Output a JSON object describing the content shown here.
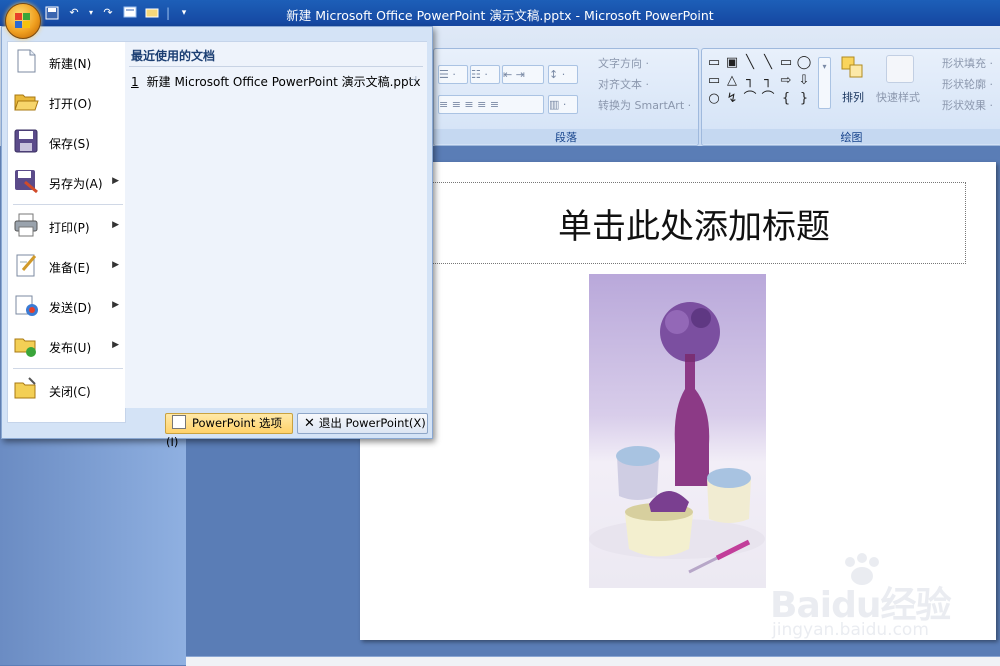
{
  "window": {
    "title": "新建 Microsoft Office PowerPoint 演示文稿.pptx - Microsoft PowerPoint"
  },
  "quick_access": {
    "customize": "▾"
  },
  "ribbon": {
    "paragraph": {
      "label": "段落",
      "text_direction": "文字方向 ·",
      "align_text": "对齐文本 ·",
      "convert_smartart": "转换为 SmartArt ·"
    },
    "drawing": {
      "label": "绘图",
      "arrange": "排列",
      "quick_styles": "快速样式",
      "shape_fill": "形状填充 ·",
      "shape_outline": "形状轮廓 ·",
      "shape_effects": "形状效果 ·"
    }
  },
  "slide": {
    "title_placeholder": "单击此处添加标题"
  },
  "office_menu": {
    "items": [
      {
        "label": "新建(N)",
        "icon": "new-document-icon",
        "arrow": ""
      },
      {
        "label": "打开(O)",
        "icon": "open-folder-icon",
        "arrow": ""
      },
      {
        "label": "保存(S)",
        "icon": "save-disk-icon",
        "arrow": ""
      },
      {
        "label": "另存为(A)",
        "icon": "save-as-icon",
        "arrow": "▶"
      },
      {
        "label": "打印(P)",
        "icon": "printer-icon",
        "arrow": "▶"
      },
      {
        "label": "准备(E)",
        "icon": "prepare-icon",
        "arrow": "▶"
      },
      {
        "label": "发送(D)",
        "icon": "send-icon",
        "arrow": "▶"
      },
      {
        "label": "发布(U)",
        "icon": "publish-icon",
        "arrow": "▶"
      },
      {
        "label": "关闭(C)",
        "icon": "close-folder-icon",
        "arrow": ""
      }
    ],
    "recent": {
      "header": "最近使用的文档",
      "items": [
        {
          "num": "1",
          "name": "新建 Microsoft Office PowerPoint 演示文稿.pptx"
        }
      ]
    },
    "options_button": "PowerPoint 选项(I)",
    "exit_button": "退出 PowerPoint(X)"
  },
  "watermark": {
    "main": "Baidu经验",
    "sub": "jingyan.baidu.com"
  }
}
